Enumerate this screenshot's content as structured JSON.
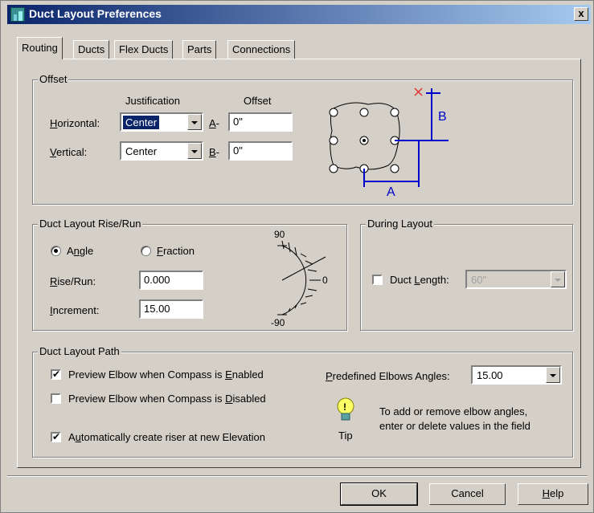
{
  "window": {
    "title": "Duct Layout Preferences",
    "close_label": "x"
  },
  "tabs": [
    {
      "label": "Routing"
    },
    {
      "label": "Ducts"
    },
    {
      "label": "Flex Ducts"
    },
    {
      "label": "Parts"
    },
    {
      "label": "Connections"
    }
  ],
  "offset": {
    "title": "Offset",
    "justification_header": "Justification",
    "offset_header": "Offset",
    "horizontal_label": "Horizontal:",
    "horizontal_value": "Center",
    "vertical_label": "Vertical:",
    "vertical_value": "Center",
    "a_label": "A-",
    "a_value": "0\"",
    "b_label": "B-",
    "b_value": "0\"",
    "diagram_a": "A",
    "diagram_b": "B"
  },
  "rise_run": {
    "title": "Duct Layout Rise/Run",
    "angle_label": "Angle",
    "fraction_label": "Fraction",
    "selected": "Angle",
    "rise_run_label": "Rise/Run:",
    "rise_run_value": "0.000",
    "increment_label": "Increment:",
    "increment_value": "15.00",
    "gauge_top": "90",
    "gauge_mid": "0",
    "gauge_bottom": "-90"
  },
  "during_layout": {
    "title": "During Layout",
    "duct_length_label": "Duct Length:",
    "duct_length_checked": false,
    "duct_length_value": "60\""
  },
  "path": {
    "title": "Duct Layout Path",
    "preview_enabled_label": "Preview Elbow when Compass is Enabled",
    "preview_enabled_checked": true,
    "preview_disabled_label": "Preview Elbow when Compass is Disabled",
    "preview_disabled_checked": false,
    "auto_riser_label": "Automatically create riser at new Elevation",
    "auto_riser_checked": true,
    "elbow_angles_label": "Predefined Elbows Angles:",
    "elbow_angles_value": "15.00",
    "tip_label": "Tip",
    "tip_line1": "To add or remove elbow angles,",
    "tip_line2": "enter or delete values in the field"
  },
  "buttons": {
    "ok": "OK",
    "cancel": "Cancel",
    "help": "Help"
  },
  "colors": {
    "title_start": "#0a246a",
    "title_end": "#a6caf0",
    "diagram_blue": "#0000cc",
    "marker_red": "#e03030",
    "tip_yellow": "#ffff66"
  }
}
